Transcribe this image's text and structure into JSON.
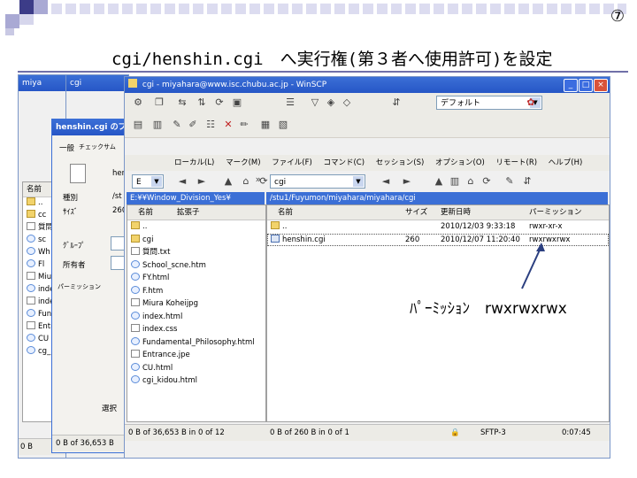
{
  "slide": {
    "number": "⑦",
    "title": "cgi/henshin.cgi　へ実行権(第３者へ使用許可)を設定"
  },
  "winscp": {
    "title": "cgi - miyahara@www.isc.chubu.ac.jp - WinSCP",
    "back_window_titles": [
      "miya",
      "cgi",
      "cgi"
    ],
    "session_combo": "デフォルト",
    "menu": [
      "ローカル(L)",
      "マーク(M)",
      "ファイル(F)",
      "コマンド(C)",
      "セッション(S)",
      "オプション(O)",
      "リモート(R)",
      "ヘルプ(H)"
    ],
    "local": {
      "drive": "E",
      "path": "E:¥¥Window_Division_Yes¥",
      "columns": [
        "名前",
        "拡張子"
      ],
      "files": [
        {
          "name": "..",
          "type": "folder"
        },
        {
          "name": "cgi",
          "type": "folder"
        },
        {
          "name": "質問.txt",
          "type": "file"
        },
        {
          "name": "School_scne.htm",
          "type": "html"
        },
        {
          "name": "FY.html",
          "type": "html"
        },
        {
          "name": "F.htm",
          "type": "html"
        },
        {
          "name": "Miura Koheijpg",
          "type": "file"
        },
        {
          "name": "index.html",
          "type": "html"
        },
        {
          "name": "index.css",
          "type": "file"
        },
        {
          "name": "Fundamental_Philosophy.html",
          "type": "html"
        },
        {
          "name": "Entrance.jpe",
          "type": "file"
        },
        {
          "name": "CU.html",
          "type": "html"
        },
        {
          "name": "cgi_kidou.html",
          "type": "html"
        }
      ],
      "status": "0 B of 36,653 B in 0 of 12"
    },
    "remote": {
      "folder": "cgi",
      "path": "/stu1/Fuyumon/miyahara/miyahara/cgi",
      "columns": [
        "名前",
        "サイズ",
        "更新日時",
        "パーミッション"
      ],
      "files": [
        {
          "name": "..",
          "type": "folder",
          "size": "",
          "date": "2010/12/03 9:33:18",
          "perm": "rwxr-xr-x"
        },
        {
          "name": "henshin.cgi",
          "type": "cgi",
          "size": "260",
          "date": "2010/12/07 11:20:40",
          "perm": "rwxrwxrwx"
        }
      ],
      "status": "0 B of 260 B in 0 of 1"
    },
    "protocol": "SFTP-3",
    "elapsed": "0:07:45"
  },
  "dialog": {
    "title": "henshin.cgi のプロパティ",
    "tabs": [
      "一般",
      "チェックサム"
    ],
    "file_label": "hen",
    "labels": [
      "種別",
      "ｻｲｽﾞ",
      "ｸﾞﾙｰﾌﾟ",
      "所有者",
      "パーミッション"
    ],
    "values": [
      "/st",
      "260"
    ],
    "left_status": "0 B of 36,653 B",
    "back_left_status": "0 B",
    "back_left_item": "選択"
  },
  "back_window": {
    "col_name": "名前",
    "items": [
      "..",
      "cc",
      "質問",
      "sc",
      "Wh",
      "Fl",
      "Miura",
      "index",
      "index",
      "Fund",
      "Entr",
      "CU",
      "cg_k"
    ]
  },
  "annotation": {
    "label": "ﾊﾟｰﾐｯｼｮﾝ　rwxrwxrwx"
  },
  "colors": {
    "titlebar": "#2656c6",
    "accent": "#3b6fd6",
    "decor_dark": "#3c3c88",
    "decor_light": "#a9a9d4"
  }
}
